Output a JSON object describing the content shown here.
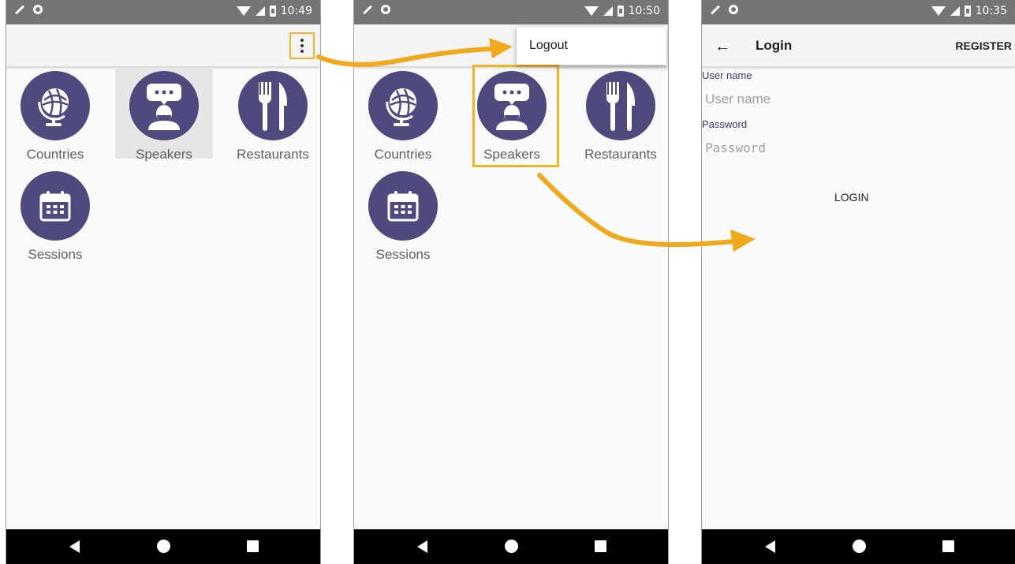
{
  "phone1": {
    "status_time": "10:49",
    "items": [
      {
        "label": "Countries"
      },
      {
        "label": "Speakers"
      },
      {
        "label": "Restaurants"
      },
      {
        "label": "Sessions"
      }
    ]
  },
  "phone2": {
    "status_time": "10:50",
    "menu": {
      "logout_label": "Logout"
    },
    "items": [
      {
        "label": "Countries"
      },
      {
        "label": "Speakers"
      },
      {
        "label": "Restaurants"
      },
      {
        "label": "Sessions"
      }
    ]
  },
  "phone3": {
    "status_time": "10:35",
    "title": "Login",
    "register_label": "REGISTER",
    "username": {
      "label": "User name",
      "placeholder": "User name"
    },
    "password": {
      "label": "Password",
      "placeholder": "Password"
    },
    "login_label": "LOGIN"
  },
  "colors": {
    "accent_highlight": "#f0b429",
    "icon_circle": "#4e4a7e",
    "status_bar": "#757575",
    "app_bar": "#f5f5f5",
    "nav_bar": "#000000"
  },
  "icons": [
    "globe-icon",
    "speaker-icon",
    "cutlery-icon",
    "calendar-icon",
    "overflow-menu-icon",
    "back-arrow-icon"
  ]
}
